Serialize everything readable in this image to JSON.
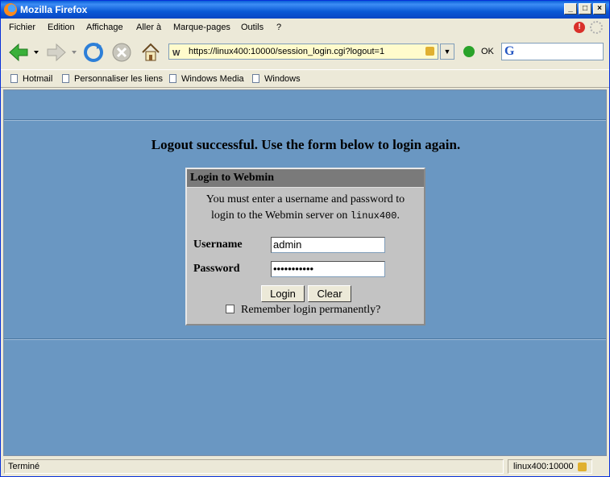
{
  "window": {
    "title": "Mozilla Firefox",
    "minimize": "_",
    "maximize": "□",
    "close": "×"
  },
  "menu": [
    "Fichier",
    "Edition",
    "Affichage",
    "Aller à",
    "Marque-pages",
    "Outils",
    "?"
  ],
  "nav": {
    "url": "https://linux400:10000/session_login.cgi?logout=1",
    "go_label": "OK",
    "search_logo": "G"
  },
  "bookmarks": [
    "Hotmail",
    "Personnaliser les liens",
    "Windows Media",
    "Windows"
  ],
  "page": {
    "heading": "Logout successful. Use the form below to login again.",
    "login": {
      "title": "Login to Webmin",
      "message_line1": "You must enter a username and password to",
      "message_line2_prefix": "login to the Webmin server on ",
      "host": "linux400",
      "message_line2_suffix": ".",
      "username_label": "Username",
      "username_value": "admin",
      "password_label": "Password",
      "password_value": "•••••••••••",
      "login_button": "Login",
      "clear_button": "Clear",
      "remember_label": "Remember login permanently?"
    }
  },
  "status": {
    "text": "Terminé",
    "host": "linux400:10000"
  }
}
